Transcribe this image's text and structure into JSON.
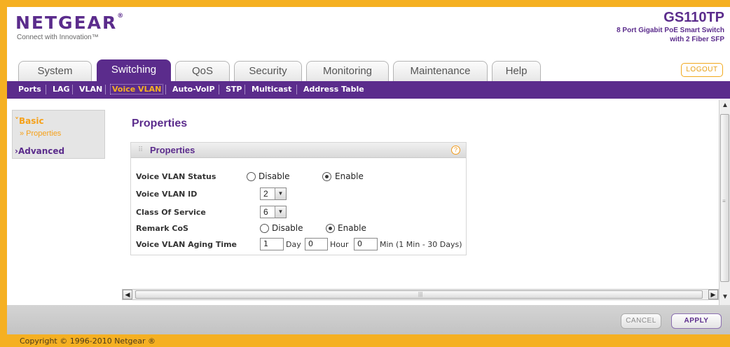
{
  "header": {
    "logo": "NETGEAR",
    "logo_mark": "®",
    "tagline": "Connect with Innovation™",
    "model": "GS110TP",
    "model_desc_line1": "8 Port Gigabit PoE Smart Switch",
    "model_desc_line2": "with 2 Fiber SFP"
  },
  "tabs": [
    "System",
    "Switching",
    "QoS",
    "Security",
    "Monitoring",
    "Maintenance",
    "Help"
  ],
  "active_tab": "Switching",
  "logout_label": "LOGOUT",
  "subnav": [
    "Ports",
    "LAG",
    "VLAN",
    "Voice VLAN",
    "Auto-VoIP",
    "STP",
    "Multicast",
    "Address Table"
  ],
  "active_subnav": "Voice VLAN",
  "left_nav": {
    "basic": "˅Basic",
    "properties": "» Properties",
    "advanced": "›Advanced"
  },
  "page_title": "Properties",
  "panel": {
    "title": "Properties",
    "help_icon": "?",
    "rows": {
      "status_label": "Voice VLAN Status",
      "status_disable": "Disable",
      "status_enable": "Enable",
      "id_label": "Voice VLAN ID",
      "id_value": "2",
      "cos_label": "Class Of Service",
      "cos_value": "6",
      "remark_label": "Remark CoS",
      "remark_disable": "Disable",
      "remark_enable": "Enable",
      "aging_label": "Voice VLAN Aging Time",
      "aging_day": "1",
      "day_unit": "Day",
      "aging_hour": "0",
      "hour_unit": "Hour",
      "aging_min": "0",
      "min_unit": "Min (1 Min - 30 Days)"
    }
  },
  "buttons": {
    "cancel": "CANCEL",
    "apply": "APPLY"
  },
  "footer": "Copyright © 1996-2010 Netgear ®",
  "colors": {
    "brand_purple": "#5b2c8c",
    "accent_orange": "#f5b022"
  }
}
